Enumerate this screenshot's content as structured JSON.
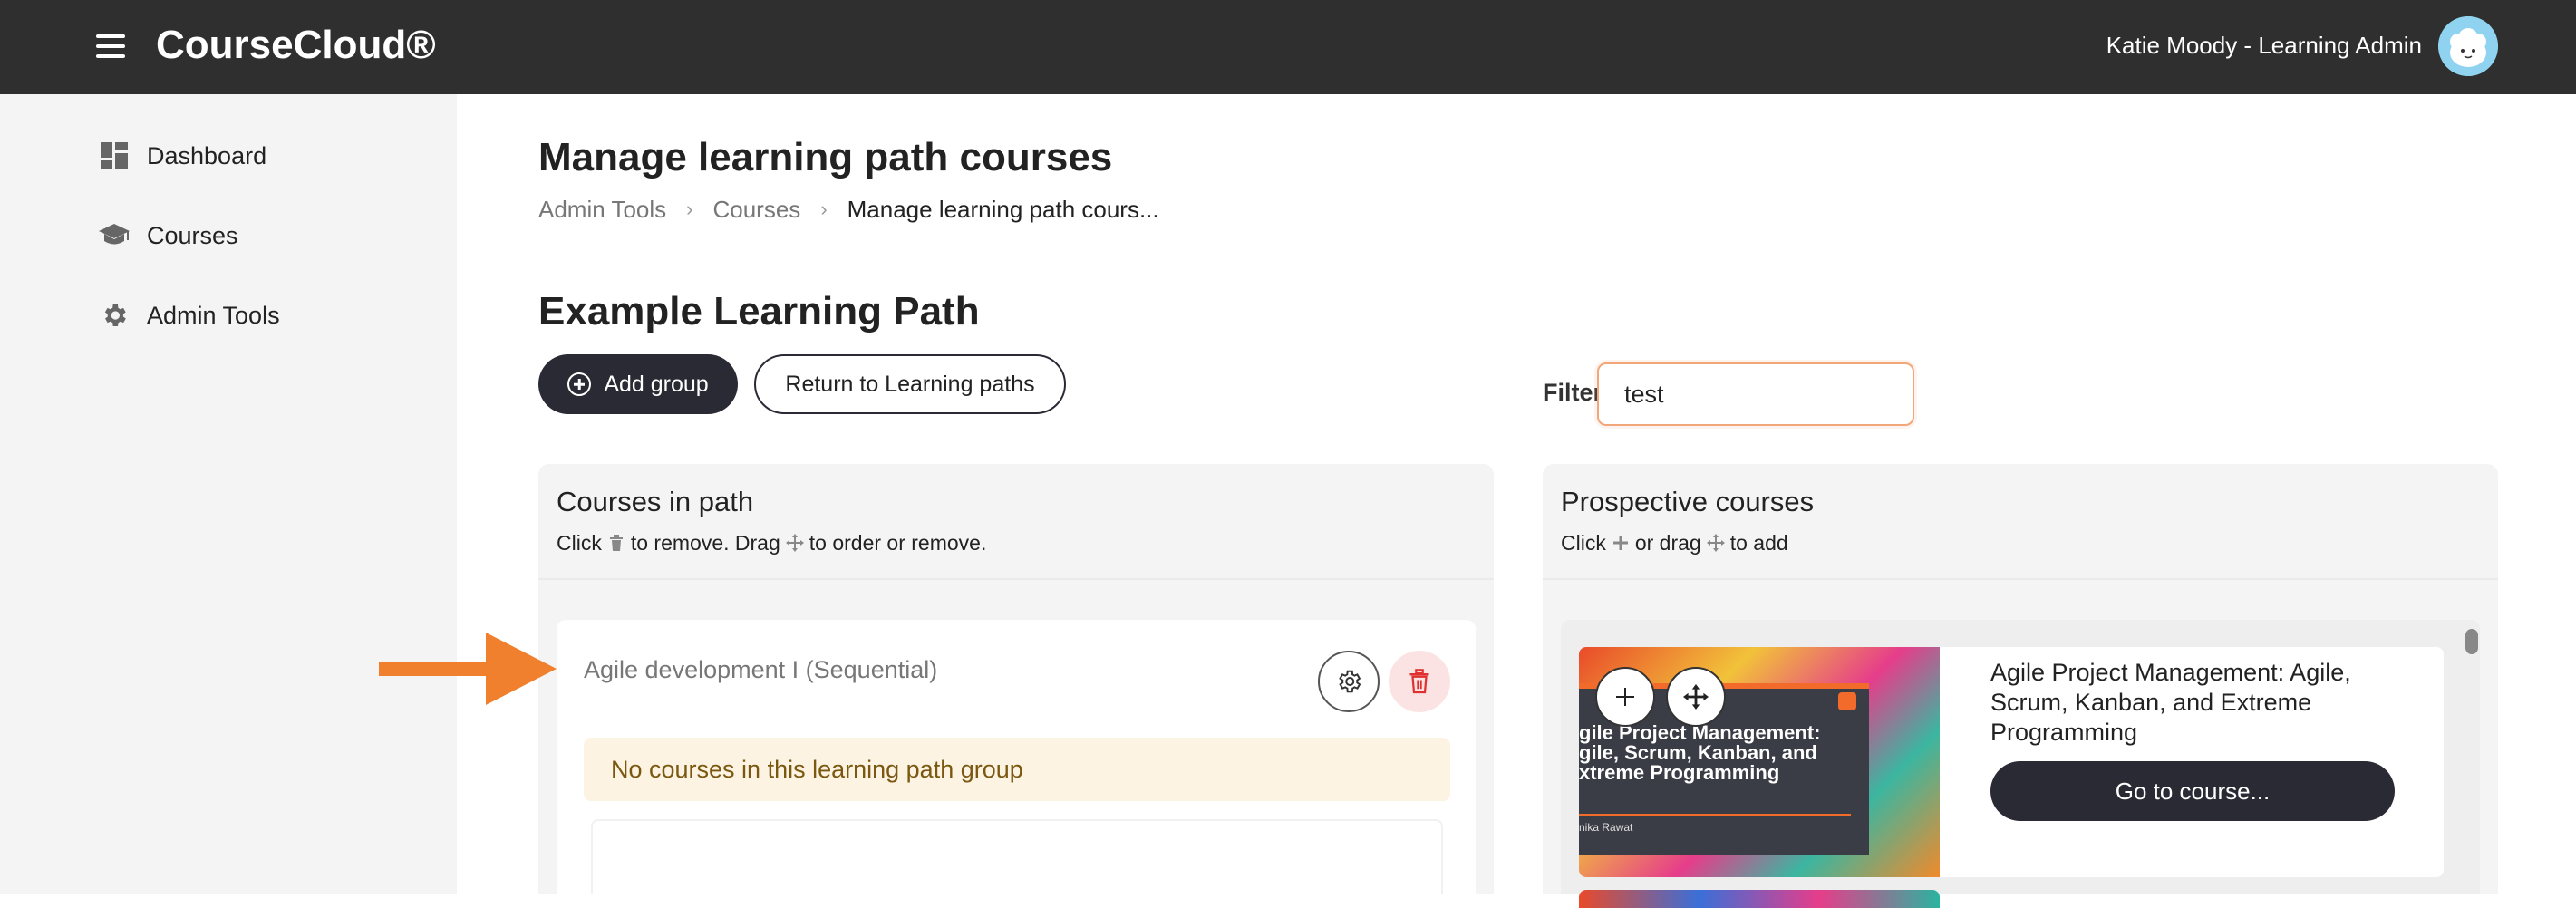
{
  "header": {
    "brand": "CourseCloud®",
    "user": "Katie Moody - Learning Admin"
  },
  "sidebar": {
    "items": [
      {
        "label": "Dashboard",
        "icon": "dashboard-icon"
      },
      {
        "label": "Courses",
        "icon": "graduation-cap-icon"
      },
      {
        "label": "Admin Tools",
        "icon": "gear-icon"
      }
    ]
  },
  "page": {
    "title": "Manage learning path courses",
    "breadcrumb": [
      "Admin Tools",
      "Courses",
      "Manage learning path cours..."
    ],
    "path_title": "Example Learning Path",
    "add_group_label": "Add group",
    "return_label": "Return to Learning paths",
    "filter_label": "Filter",
    "filter_value": "test"
  },
  "courses_in_path": {
    "title": "Courses in path",
    "help_click": "Click",
    "help_remove": "to remove. Drag",
    "help_order": "to order or remove.",
    "group": {
      "title": "Agile development I (Sequential)",
      "empty_message": "No courses in this learning path group"
    }
  },
  "prospective": {
    "title": "Prospective courses",
    "help_click": "Click",
    "help_drag": "or drag",
    "help_add": "to add",
    "courses": [
      {
        "name": "Agile Project Management: Agile, Scrum, Kanban, and Extreme Programming",
        "thumb_title": "gile Project Management:\ngile, Scrum, Kanban, and\nxtreme Programming",
        "thumb_author": "nika Rawat",
        "action_label": "Go to course..."
      }
    ]
  },
  "colors": {
    "topbar": "#2f2f2f",
    "primary_button": "#2a2a34",
    "accent_arrow": "#f07f2e",
    "filter_border": "#f1a77a",
    "alert_bg": "#fdf3e3",
    "delete": "#e03131"
  }
}
